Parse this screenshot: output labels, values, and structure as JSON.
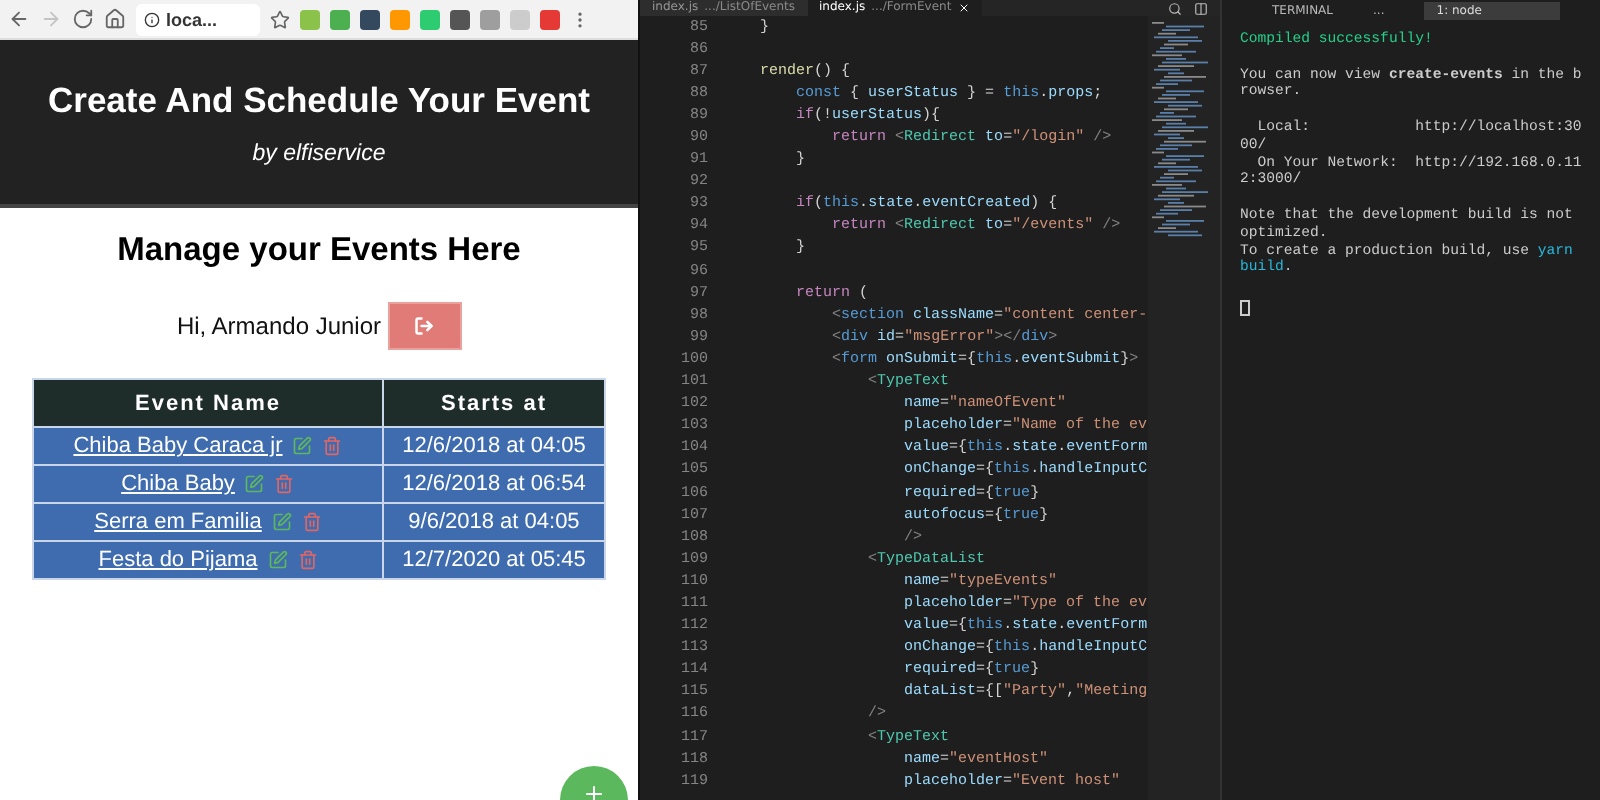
{
  "browser": {
    "nav": [
      {
        "kind": "back",
        "disabled": false
      },
      {
        "kind": "forward",
        "disabled": true
      },
      {
        "kind": "reload",
        "disabled": false
      },
      {
        "kind": "home",
        "disabled": false
      }
    ],
    "address": "loca...",
    "extensions": [
      {
        "color": "#8bc34a"
      },
      {
        "color": "#4caf50"
      },
      {
        "color": "#34495e"
      },
      {
        "color": "#ff9800"
      },
      {
        "color": "#2ecc71"
      },
      {
        "color": "#555555"
      },
      {
        "color": "#9e9e9e"
      },
      {
        "color": "#cccccc"
      },
      {
        "color": "#e53935"
      }
    ]
  },
  "page": {
    "title": "Create And Schedule Your Event",
    "subtitle": "by elfiservice",
    "heading": "Manage your Events Here",
    "greeting": "Hi, Armando Junior",
    "columns": [
      "Event Name",
      "Starts at"
    ],
    "events": [
      {
        "name": "Chiba Baby Caraca jr",
        "starts_at": "12/6/2018 at 04:05"
      },
      {
        "name": "Chiba Baby",
        "starts_at": "12/6/2018 at 06:54"
      },
      {
        "name": "Serra em Familia",
        "starts_at": "9/6/2018 at 04:05"
      },
      {
        "name": "Festa do Pijama",
        "starts_at": "12/7/2020 at 05:45"
      }
    ]
  },
  "editor": {
    "tabs": [
      {
        "label": "index.js",
        "path": ".../ListOfEvents",
        "selected": false
      },
      {
        "label": "index.js",
        "path": ".../FormEvent",
        "selected": true
      }
    ],
    "lines": [
      {
        "number": "85",
        "segments": [
          {
            "kind": "plain",
            "text": "    }"
          }
        ]
      },
      {
        "number": "86"
      },
      {
        "number": "87",
        "segments": [
          {
            "kind": "func",
            "text": "    render"
          },
          {
            "kind": "plain",
            "text": "() {"
          }
        ]
      },
      {
        "number": "88",
        "segments": [
          {
            "kind": "storage",
            "text": "        const"
          },
          {
            "kind": "plain",
            "text": " { "
          },
          {
            "kind": "var",
            "text": "userStatus"
          },
          {
            "kind": "plain",
            "text": " } = "
          },
          {
            "kind": "storage",
            "text": "this"
          },
          {
            "kind": "plain",
            "text": "."
          },
          {
            "kind": "var",
            "text": "props"
          },
          {
            "kind": "plain",
            "text": ";"
          }
        ]
      },
      {
        "number": "89",
        "segments": [
          {
            "kind": "keyword",
            "text": "        if"
          },
          {
            "kind": "plain",
            "text": "(!"
          },
          {
            "kind": "var",
            "text": "userStatus"
          },
          {
            "kind": "plain",
            "text": "){"
          }
        ]
      },
      {
        "number": "90",
        "segments": [
          {
            "kind": "keyword",
            "text": "            return "
          },
          {
            "kind": "punct",
            "text": "<"
          },
          {
            "kind": "tag",
            "text": "Redirect"
          },
          {
            "kind": "var",
            "text": " to"
          },
          {
            "kind": "plain",
            "text": "="
          },
          {
            "kind": "string",
            "text": "\"/login\""
          },
          {
            "kind": "punct",
            "text": " />"
          }
        ]
      },
      {
        "number": "91",
        "segments": [
          {
            "kind": "plain",
            "text": "        }"
          }
        ]
      },
      {
        "number": "92"
      },
      {
        "number": "93",
        "segments": [
          {
            "kind": "keyword",
            "text": "        if"
          },
          {
            "kind": "plain",
            "text": "("
          },
          {
            "kind": "storage",
            "text": "this"
          },
          {
            "kind": "plain",
            "text": "."
          },
          {
            "kind": "var",
            "text": "state"
          },
          {
            "kind": "plain",
            "text": "."
          },
          {
            "kind": "var",
            "text": "eventCreated"
          },
          {
            "kind": "plain",
            "text": ") {"
          }
        ]
      },
      {
        "number": "94",
        "segments": [
          {
            "kind": "keyword",
            "text": "            return "
          },
          {
            "kind": "punct",
            "text": "<"
          },
          {
            "kind": "tag",
            "text": "Redirect"
          },
          {
            "kind": "var",
            "text": " to"
          },
          {
            "kind": "plain",
            "text": "="
          },
          {
            "kind": "string",
            "text": "\"/events\""
          },
          {
            "kind": "punct",
            "text": " />"
          }
        ]
      },
      {
        "number": "95",
        "segments": [
          {
            "kind": "plain",
            "text": "        }"
          }
        ]
      },
      {
        "number": "96"
      },
      {
        "number": "97",
        "segments": [
          {
            "kind": "keyword",
            "text": "        return"
          },
          {
            "kind": "plain",
            "text": " ("
          }
        ]
      },
      {
        "number": "98",
        "segments": [
          {
            "kind": "punct",
            "text": "            <"
          },
          {
            "kind": "storage",
            "text": "section"
          },
          {
            "kind": "var",
            "text": " className"
          },
          {
            "kind": "plain",
            "text": "="
          },
          {
            "kind": "string",
            "text": "\"content center-"
          }
        ]
      },
      {
        "number": "99",
        "segments": [
          {
            "kind": "punct",
            "text": "            <"
          },
          {
            "kind": "storage",
            "text": "div"
          },
          {
            "kind": "var",
            "text": " id"
          },
          {
            "kind": "plain",
            "text": "="
          },
          {
            "kind": "string",
            "text": "\"msgError\""
          },
          {
            "kind": "punct",
            "text": "></"
          },
          {
            "kind": "storage",
            "text": "div"
          },
          {
            "kind": "punct",
            "text": ">"
          }
        ]
      },
      {
        "number": "100",
        "segments": [
          {
            "kind": "punct",
            "text": "            <"
          },
          {
            "kind": "storage",
            "text": "form"
          },
          {
            "kind": "var",
            "text": " onSubmit"
          },
          {
            "kind": "plain",
            "text": "={"
          },
          {
            "kind": "storage",
            "text": "this"
          },
          {
            "kind": "plain",
            "text": "."
          },
          {
            "kind": "var",
            "text": "eventSubmit"
          },
          {
            "kind": "plain",
            "text": "}"
          },
          {
            "kind": "punct",
            "text": ">"
          }
        ]
      },
      {
        "number": "101",
        "segments": [
          {
            "kind": "punct",
            "text": "                <"
          },
          {
            "kind": "tag",
            "text": "TypeText"
          }
        ]
      },
      {
        "number": "102",
        "segments": [
          {
            "kind": "var",
            "text": "                    name"
          },
          {
            "kind": "plain",
            "text": "="
          },
          {
            "kind": "string",
            "text": "\"nameOfEvent\""
          }
        ]
      },
      {
        "number": "103",
        "segments": [
          {
            "kind": "var",
            "text": "                    placeholder"
          },
          {
            "kind": "plain",
            "text": "="
          },
          {
            "kind": "string",
            "text": "\"Name of the ev"
          }
        ]
      },
      {
        "number": "104",
        "segments": [
          {
            "kind": "var",
            "text": "                    value"
          },
          {
            "kind": "plain",
            "text": "={"
          },
          {
            "kind": "storage",
            "text": "this"
          },
          {
            "kind": "plain",
            "text": "."
          },
          {
            "kind": "var",
            "text": "state"
          },
          {
            "kind": "plain",
            "text": "."
          },
          {
            "kind": "var",
            "text": "eventForm"
          }
        ]
      },
      {
        "number": "105",
        "segments": [
          {
            "kind": "var",
            "text": "                    onChange"
          },
          {
            "kind": "plain",
            "text": "={"
          },
          {
            "kind": "storage",
            "text": "this"
          },
          {
            "kind": "plain",
            "text": "."
          },
          {
            "kind": "var",
            "text": "handleInputC"
          }
        ]
      },
      {
        "number": "106",
        "segments": [
          {
            "kind": "var",
            "text": "                    required"
          },
          {
            "kind": "plain",
            "text": "={"
          },
          {
            "kind": "storage",
            "text": "true"
          },
          {
            "kind": "plain",
            "text": "}"
          }
        ]
      },
      {
        "number": "107",
        "segments": [
          {
            "kind": "var",
            "text": "                    autofocus"
          },
          {
            "kind": "plain",
            "text": "={"
          },
          {
            "kind": "storage",
            "text": "true"
          },
          {
            "kind": "plain",
            "text": "}"
          }
        ]
      },
      {
        "number": "108",
        "segments": [
          {
            "kind": "punct",
            "text": "                    />"
          }
        ]
      },
      {
        "number": "109",
        "segments": [
          {
            "kind": "punct",
            "text": "                <"
          },
          {
            "kind": "tag",
            "text": "TypeDataList"
          }
        ]
      },
      {
        "number": "110",
        "segments": [
          {
            "kind": "var",
            "text": "                    name"
          },
          {
            "kind": "plain",
            "text": "="
          },
          {
            "kind": "string",
            "text": "\"typeEvents\""
          }
        ]
      },
      {
        "number": "111",
        "segments": [
          {
            "kind": "var",
            "text": "                    placeholder"
          },
          {
            "kind": "plain",
            "text": "="
          },
          {
            "kind": "string",
            "text": "\"Type of the ev"
          }
        ]
      },
      {
        "number": "112",
        "segments": [
          {
            "kind": "var",
            "text": "                    value"
          },
          {
            "kind": "plain",
            "text": "={"
          },
          {
            "kind": "storage",
            "text": "this"
          },
          {
            "kind": "plain",
            "text": "."
          },
          {
            "kind": "var",
            "text": "state"
          },
          {
            "kind": "plain",
            "text": "."
          },
          {
            "kind": "var",
            "text": "eventForm"
          }
        ]
      },
      {
        "number": "113",
        "segments": [
          {
            "kind": "var",
            "text": "                    onChange"
          },
          {
            "kind": "plain",
            "text": "={"
          },
          {
            "kind": "storage",
            "text": "this"
          },
          {
            "kind": "plain",
            "text": "."
          },
          {
            "kind": "var",
            "text": "handleInputC"
          }
        ]
      },
      {
        "number": "114",
        "segments": [
          {
            "kind": "var",
            "text": "                    required"
          },
          {
            "kind": "plain",
            "text": "={"
          },
          {
            "kind": "storage",
            "text": "true"
          },
          {
            "kind": "plain",
            "text": "}"
          }
        ]
      },
      {
        "number": "115",
        "segments": [
          {
            "kind": "var",
            "text": "                    dataList"
          },
          {
            "kind": "plain",
            "text": "={["
          },
          {
            "kind": "string",
            "text": "\"Party\""
          },
          {
            "kind": "plain",
            "text": ","
          },
          {
            "kind": "string",
            "text": "\"Meeting"
          }
        ]
      },
      {
        "number": "116",
        "segments": [
          {
            "kind": "punct",
            "text": "                />"
          }
        ]
      },
      {
        "number": "117",
        "segments": [
          {
            "kind": "punct",
            "text": "                <"
          },
          {
            "kind": "tag",
            "text": "TypeText"
          }
        ]
      },
      {
        "number": "118",
        "segments": [
          {
            "kind": "var",
            "text": "                    name"
          },
          {
            "kind": "plain",
            "text": "="
          },
          {
            "kind": "string",
            "text": "\"eventHost\""
          }
        ]
      },
      {
        "number": "119",
        "segments": [
          {
            "kind": "var",
            "text": "                    placeholder"
          },
          {
            "kind": "plain",
            "text": "="
          },
          {
            "kind": "string",
            "text": "\"Event host\""
          }
        ]
      }
    ]
  },
  "terminal": {
    "title": "TERMINAL",
    "more": "...",
    "shell": "1: node",
    "lines": [
      {
        "kind": "success",
        "text": "Compiled successfully!"
      },
      {
        "kind": "blank"
      },
      {
        "kind": "text",
        "text": "You can now view **create-events** in the browser."
      },
      {
        "kind": "blank"
      },
      {
        "kind": "text",
        "text": "  Local:            http://localhost:3000/"
      },
      {
        "kind": "text",
        "text": "  On Your Network:  http://192.168.0.112:3000/"
      },
      {
        "kind": "blank"
      },
      {
        "kind": "text",
        "text": "Note that the development build is not optimized."
      },
      {
        "kind": "mixed",
        "segments": [
          {
            "kind": "plain",
            "text": "To create a production build, use "
          },
          {
            "kind": "link",
            "text": "yarn build"
          },
          {
            "kind": "plain",
            "text": "."
          }
        ]
      },
      {
        "kind": "blank"
      },
      {
        "kind": "cursor"
      }
    ]
  }
}
